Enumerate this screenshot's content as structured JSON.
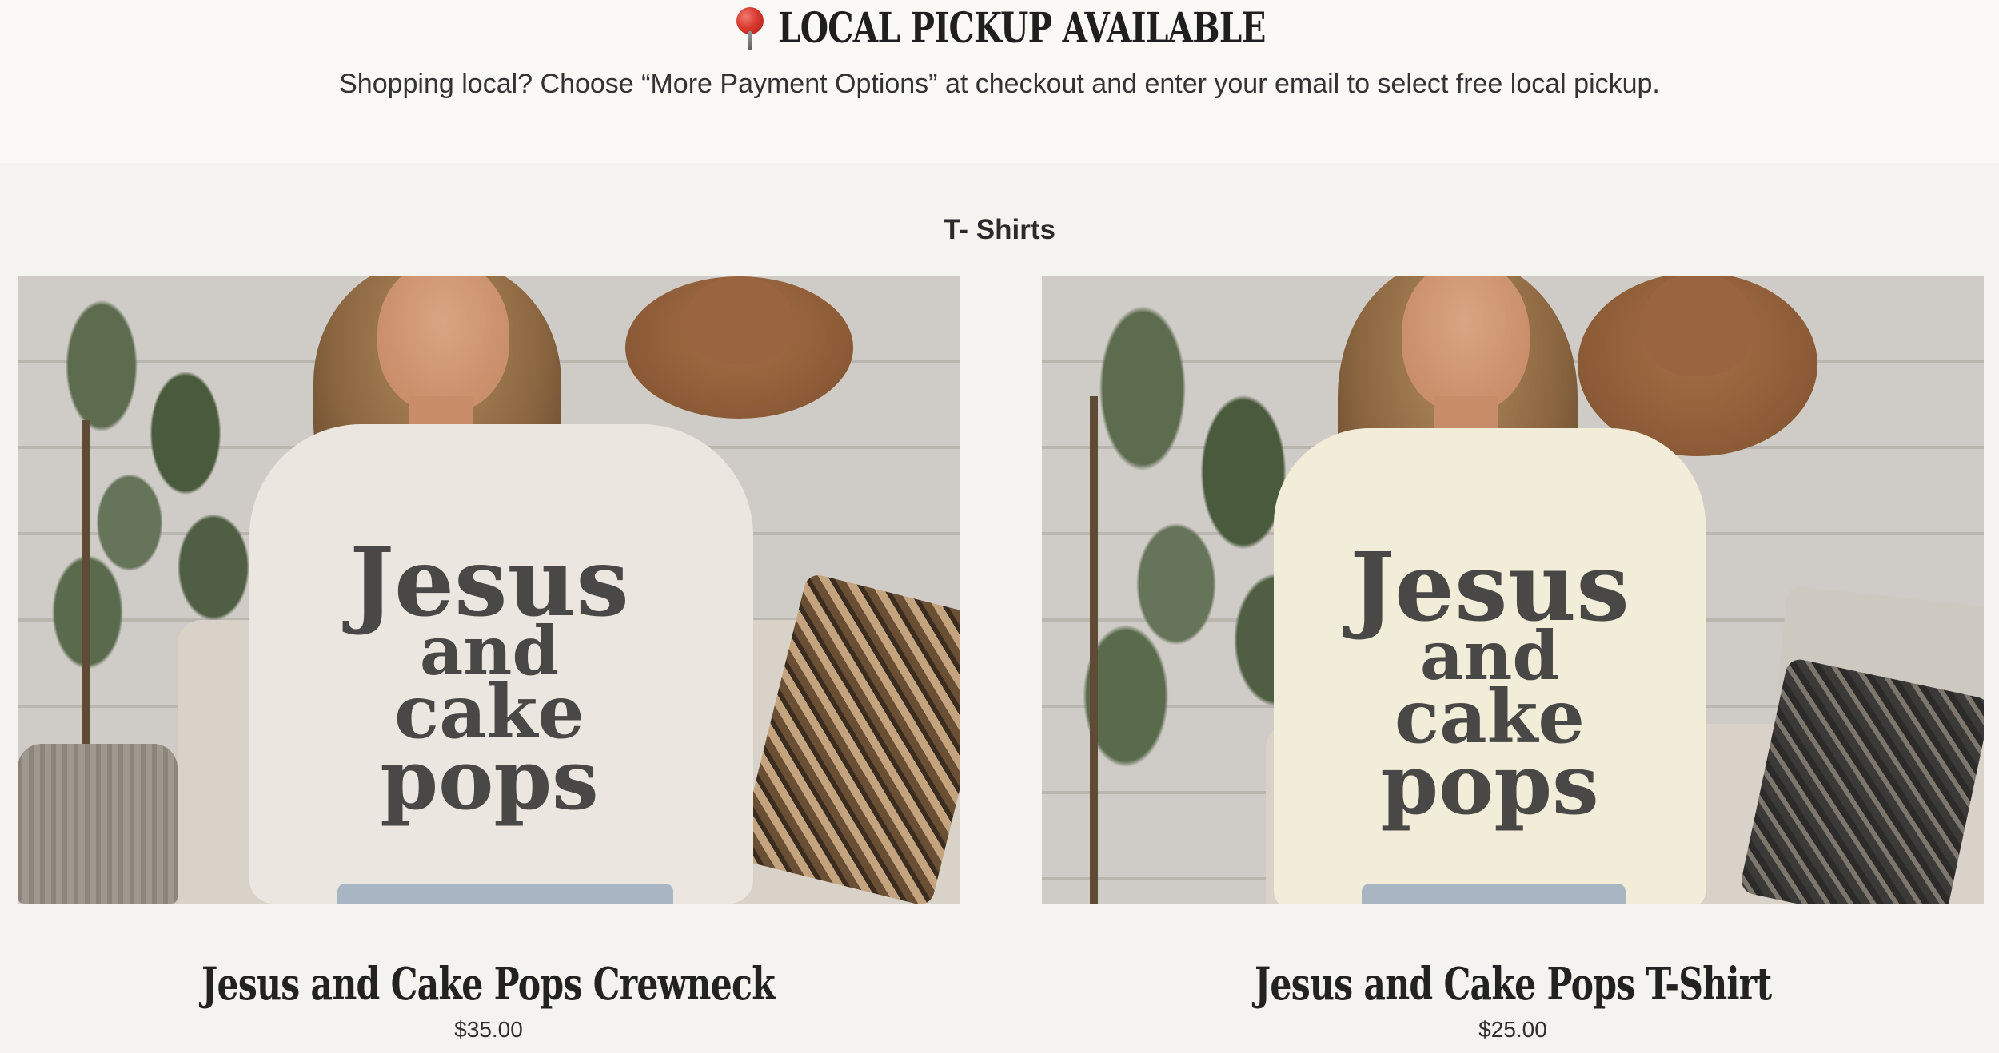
{
  "announcement": {
    "icon": "round-pushpin-icon",
    "headline": "LOCAL PICKUP AVAILABLE",
    "subtext": "Shopping local? Choose “More Payment Options” at checkout and enter your email to select free local pickup."
  },
  "collection": {
    "title": "T- Shirts",
    "products": [
      {
        "name": "Jesus and Cake Pops Crewneck",
        "price": "$35.00",
        "print_lines": [
          "Jesus",
          "and",
          "cake",
          "pops"
        ]
      },
      {
        "name": "Jesus and Cake Pops T-Shirt",
        "price": "$25.00",
        "print_lines": [
          "Jesus",
          "and",
          "cake",
          "pops"
        ]
      }
    ]
  },
  "colors": {
    "page_background": "#f4f3ef",
    "banner_background": "#faf9f6",
    "text": "#222222",
    "pin_red": "#d93a2f"
  }
}
